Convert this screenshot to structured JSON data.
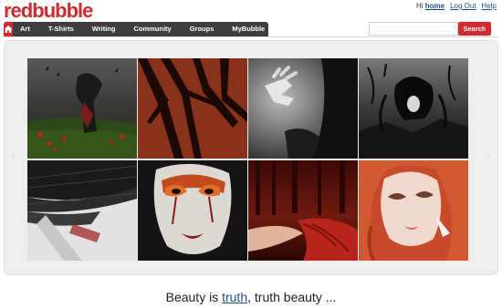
{
  "logo": {
    "part1": "red",
    "part2": "bubble"
  },
  "user_links": {
    "greeting": "Hi",
    "username": "home",
    "logout": "Log Out",
    "help": "Help"
  },
  "nav": {
    "home_icon": "home-icon",
    "items": [
      "Art",
      "T-Shirts",
      "Writing",
      "Community",
      "Groups",
      "MyBubble"
    ]
  },
  "search": {
    "placeholder": "",
    "value": "",
    "button_label": "Search"
  },
  "gallery": {
    "arrow_left": "‹",
    "arrow_right": "›",
    "tiles": [
      "dark-haired-figure-in-poppy-field",
      "tree-shadows-on-red-ground",
      "reaching-hand-in-shadow",
      "dark-haired-woman-in-black-landscape",
      "windswept-hair-closeup",
      "painted-face-with-fiery-eyes",
      "figure-with-red-hair-in-forest",
      "red-haired-woman-portrait"
    ]
  },
  "caption": {
    "before": "Beauty is ",
    "link": "truth",
    "after": ", truth beauty ..."
  },
  "colors": {
    "brand_red": "#d7282f",
    "nav_dark": "#3e3e3e",
    "link_blue": "#1a4f9c"
  }
}
